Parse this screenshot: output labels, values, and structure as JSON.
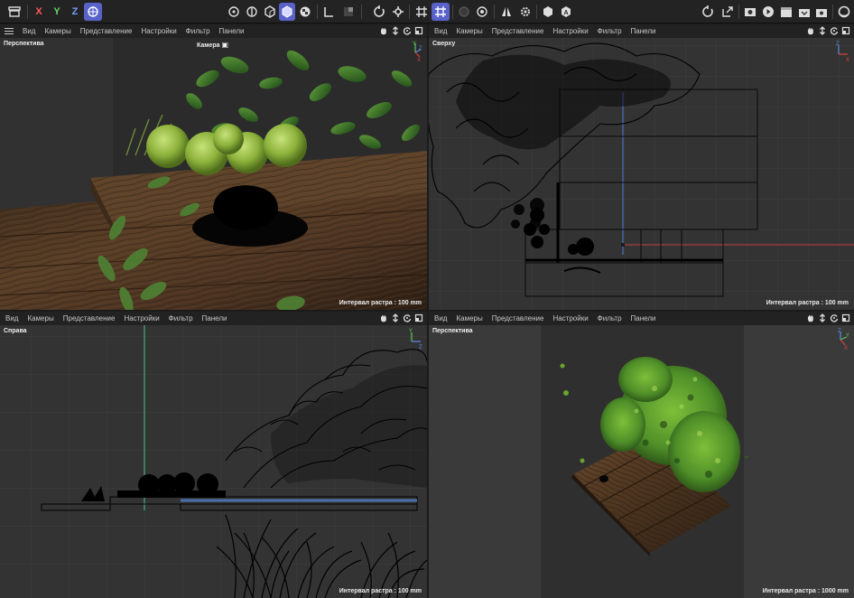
{
  "toolbar": {
    "axis_x": "X",
    "axis_y": "Y",
    "axis_z": "Z",
    "colors": {
      "accent": "#5862c8",
      "axis_x": "#e04040",
      "axis_y": "#5ac85a",
      "axis_z": "#5b8de6"
    }
  },
  "viewports": [
    {
      "id": "tl",
      "menu": [
        "Вид",
        "Камеры",
        "Представление",
        "Настройки",
        "Фильтр",
        "Панели"
      ],
      "label": "Перспектива",
      "camera_label": "Камера",
      "grid_label": "Интервал растра : 100 mm",
      "gizmo": {
        "a": "Y",
        "b": "Z",
        "c": "X"
      }
    },
    {
      "id": "tr",
      "menu": [
        "Вид",
        "Камеры",
        "Представление",
        "Настройки",
        "Фильтр",
        "Панели"
      ],
      "label": "Сверху",
      "grid_label": "Интервал растра : 100 mm",
      "gizmo": {
        "a": "Z",
        "b": "X"
      }
    },
    {
      "id": "bl",
      "menu": [
        "Вид",
        "Камеры",
        "Представление",
        "Настройки",
        "Фильтр",
        "Панели"
      ],
      "label": "Справа",
      "grid_label": "Интервал растра : 100 mm",
      "gizmo": {
        "a": "Y",
        "b": "Z"
      }
    },
    {
      "id": "br",
      "menu": [
        "Вид",
        "Камеры",
        "Представление",
        "Настройки",
        "Фильтр",
        "Панели"
      ],
      "label": "Перспектива",
      "grid_label": "Интервал растра : 1000 mm",
      "gizmo": {
        "a": "Z",
        "b": "Y",
        "c": "X"
      }
    }
  ]
}
